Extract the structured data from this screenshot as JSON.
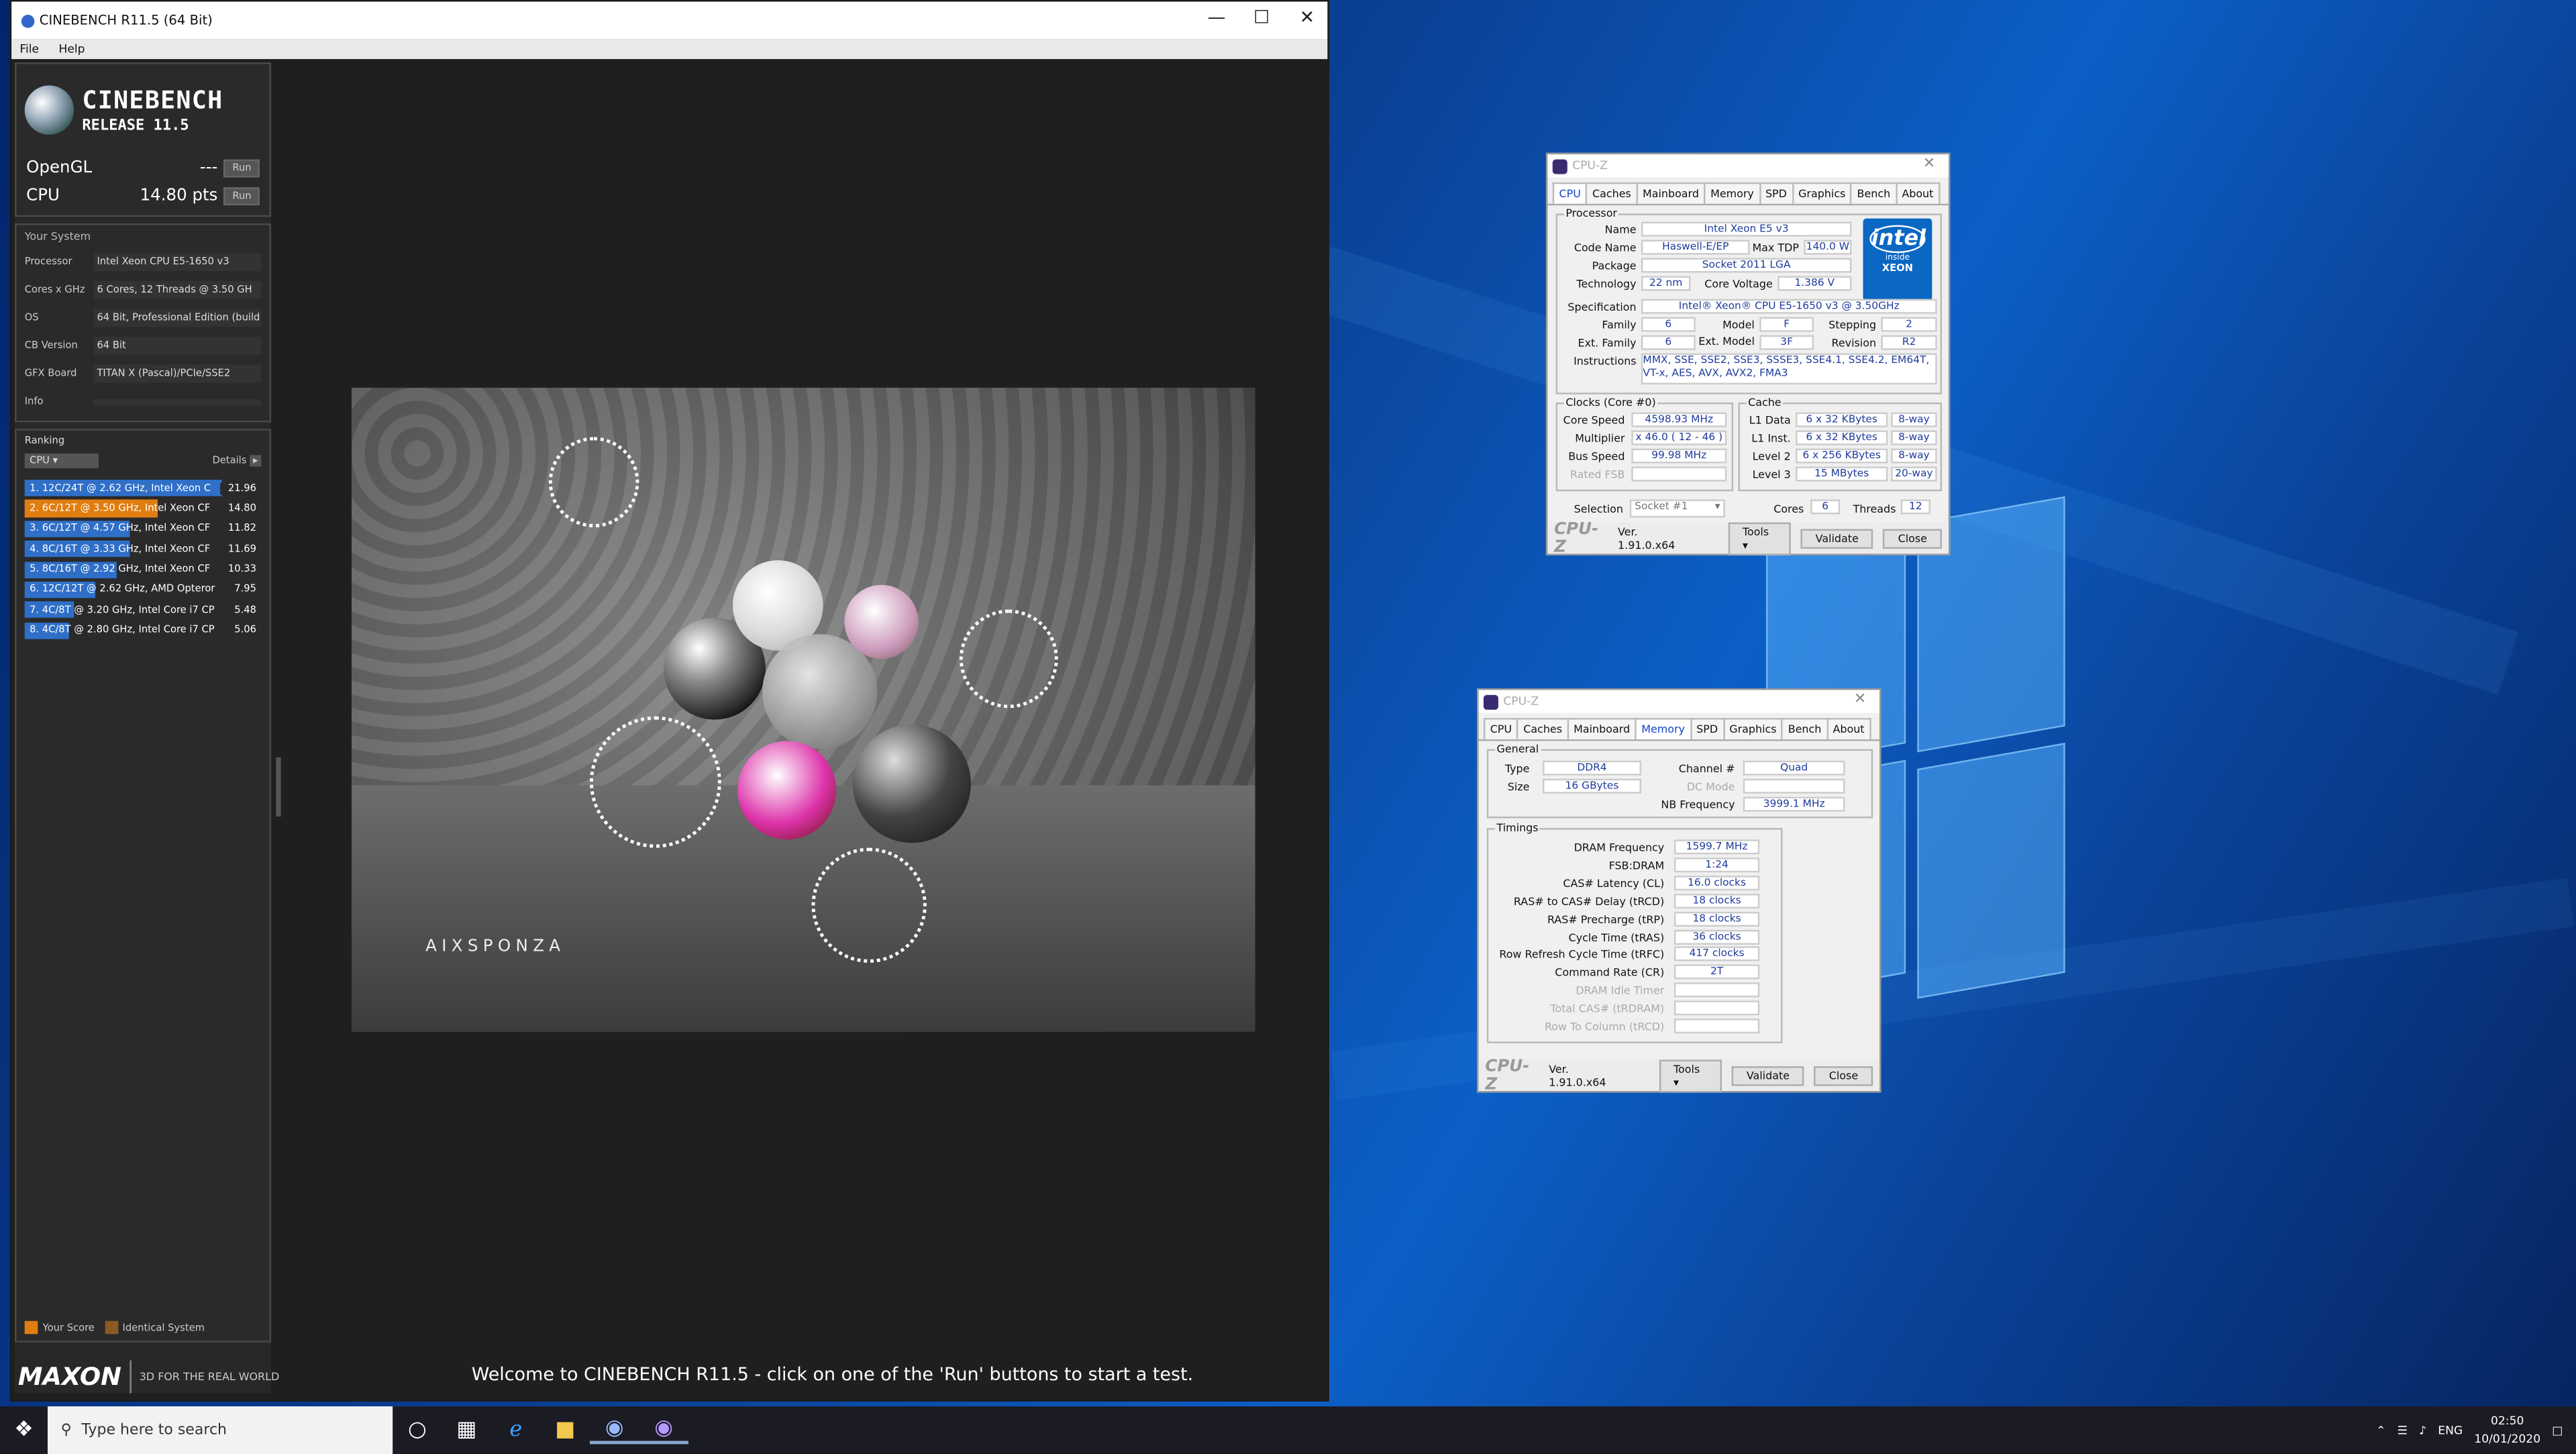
{
  "cinebench": {
    "title": "CINEBENCH R11.5 (64 Bit)",
    "menu": [
      "File",
      "Help"
    ],
    "brand_line1": "CINEBENCH",
    "brand_line2": "RELEASE 11.5",
    "opengl_label": "OpenGL",
    "opengl_value": "---",
    "cpu_label": "CPU",
    "cpu_value": "14.80 pts",
    "run_label": "Run",
    "system_header": "Your System",
    "system": [
      {
        "k": "Processor",
        "v": "Intel Xeon CPU E5-1650 v3"
      },
      {
        "k": "Cores x GHz",
        "v": "6 Cores, 12 Threads @ 3.50 GH"
      },
      {
        "k": "OS",
        "v": "64 Bit, Professional Edition (build"
      },
      {
        "k": "CB Version",
        "v": "64 Bit"
      },
      {
        "k": "GFX Board",
        "v": "TITAN X (Pascal)/PCIe/SSE2"
      },
      {
        "k": "Info",
        "v": ""
      }
    ],
    "ranking_header": "Ranking",
    "ranking_select": "CPU",
    "details_label": "Details",
    "ranking": [
      {
        "t": "1. 12C/24T @ 2.62 GHz, Intel Xeon C",
        "s": "21.96",
        "fill": 1.0,
        "color": "#2f6fc8"
      },
      {
        "t": "2. 6C/12T @ 3.50 GHz, Intel Xeon CF",
        "s": "14.80",
        "fill": 0.674,
        "color": "#e07d10"
      },
      {
        "t": "3. 6C/12T @ 4.57 GHz, Intel Xeon CF",
        "s": "11.82",
        "fill": 0.538,
        "color": "#2f6fc8"
      },
      {
        "t": "4. 8C/16T @ 3.33 GHz, Intel Xeon CF",
        "s": "11.69",
        "fill": 0.532,
        "color": "#2f6fc8"
      },
      {
        "t": "5. 8C/16T @ 2.92 GHz, Intel Xeon CF",
        "s": "10.33",
        "fill": 0.47,
        "color": "#2f6fc8"
      },
      {
        "t": "6. 12C/12T @ 2.62 GHz, AMD Opteror",
        "s": "7.95",
        "fill": 0.362,
        "color": "#2f6fc8"
      },
      {
        "t": "7. 4C/8T @ 3.20 GHz, Intel Core i7 CP",
        "s": "5.48",
        "fill": 0.25,
        "color": "#2f6fc8"
      },
      {
        "t": "8. 4C/8T @ 2.80 GHz, Intel Core i7 CP",
        "s": "5.06",
        "fill": 0.23,
        "color": "#2f6fc8"
      }
    ],
    "legend_your": "Your Score",
    "legend_identical": "Identical System",
    "maxon": "MAXON",
    "tagline": "3D FOR THE REAL WORLD",
    "render_brand": "AIXSPONZA",
    "welcome": "Welcome to CINEBENCH R11.5 - click on one of the 'Run' buttons to start a test."
  },
  "cpuz1": {
    "title": "CPU-Z",
    "tabs": [
      "CPU",
      "Caches",
      "Mainboard",
      "Memory",
      "SPD",
      "Graphics",
      "Bench",
      "About"
    ],
    "processor_label": "Processor",
    "name_label": "Name",
    "name": "Intel Xeon E5 v3",
    "codename_label": "Code Name",
    "codename": "Haswell-E/EP",
    "maxtdp_label": "Max TDP",
    "maxtdp": "140.0 W",
    "package_label": "Package",
    "package": "Socket 2011 LGA",
    "technology_label": "Technology",
    "technology": "22 nm",
    "corevoltage_label": "Core Voltage",
    "corevoltage": "1.386 V",
    "spec_label": "Specification",
    "spec": "Intel® Xeon® CPU E5-1650 v3 @ 3.50GHz",
    "family_label": "Family",
    "family": "6",
    "model_label": "Model",
    "model": "F",
    "stepping_label": "Stepping",
    "stepping": "2",
    "extfamily_label": "Ext. Family",
    "extfamily": "6",
    "extmodel_label": "Ext. Model",
    "extmodel": "3F",
    "revision_label": "Revision",
    "revision": "R2",
    "instructions_label": "Instructions",
    "instructions": "MMX, SSE, SSE2, SSE3, SSSE3, SSE4.1, SSE4.2, EM64T, VT-x, AES, AVX, AVX2, FMA3",
    "clocks_label": "Clocks (Core #0)",
    "corespeed_label": "Core Speed",
    "corespeed": "4598.93 MHz",
    "multiplier_label": "Multiplier",
    "multiplier": "x 46.0 ( 12 - 46 )",
    "busspeed_label": "Bus Speed",
    "busspeed": "99.98 MHz",
    "ratedfsb_label": "Rated FSB",
    "cache_label": "Cache",
    "l1d_label": "L1 Data",
    "l1d": "6 x 32 KBytes",
    "l1d_way": "8-way",
    "l1i_label": "L1 Inst.",
    "l1i": "6 x 32 KBytes",
    "l1i_way": "8-way",
    "l2_label": "Level 2",
    "l2": "6 x 256 KBytes",
    "l2_way": "8-way",
    "l3_label": "Level 3",
    "l3": "15 MBytes",
    "l3_way": "20-way",
    "selection_label": "Selection",
    "selection": "Socket #1",
    "cores_label": "Cores",
    "cores": "6",
    "threads_label": "Threads",
    "threads": "12",
    "logo": "CPU-Z",
    "version": "Ver. 1.91.0.x64",
    "tools": "Tools",
    "validate": "Validate",
    "close": "Close",
    "intel_brand": "intel",
    "intel_inside": "inside",
    "intel_xeon": "XEON"
  },
  "cpuz2": {
    "title": "CPU-Z",
    "tabs": [
      "CPU",
      "Caches",
      "Mainboard",
      "Memory",
      "SPD",
      "Graphics",
      "Bench",
      "About"
    ],
    "general_label": "General",
    "type_label": "Type",
    "type": "DDR4",
    "size_label": "Size",
    "size": "16 GBytes",
    "channel_label": "Channel #",
    "channel": "Quad",
    "dcmode_label": "DC Mode",
    "nbfreq_label": "NB Frequency",
    "nbfreq": "3999.1 MHz",
    "timings_label": "Timings",
    "timings": [
      {
        "k": "DRAM Frequency",
        "v": "1599.7 MHz",
        "dim": false
      },
      {
        "k": "FSB:DRAM",
        "v": "1:24",
        "dim": false
      },
      {
        "k": "CAS# Latency (CL)",
        "v": "16.0 clocks",
        "dim": false
      },
      {
        "k": "RAS# to CAS# Delay (tRCD)",
        "v": "18 clocks",
        "dim": false
      },
      {
        "k": "RAS# Precharge (tRP)",
        "v": "18 clocks",
        "dim": false
      },
      {
        "k": "Cycle Time (tRAS)",
        "v": "36 clocks",
        "dim": false
      },
      {
        "k": "Row Refresh Cycle Time (tRFC)",
        "v": "417 clocks",
        "dim": false
      },
      {
        "k": "Command Rate (CR)",
        "v": "2T",
        "dim": false
      },
      {
        "k": "DRAM Idle Timer",
        "v": "",
        "dim": true
      },
      {
        "k": "Total CAS# (tRDRAM)",
        "v": "",
        "dim": true
      },
      {
        "k": "Row To Column (tRCD)",
        "v": "",
        "dim": true
      }
    ],
    "logo": "CPU-Z",
    "version": "Ver. 1.91.0.x64",
    "tools": "Tools",
    "validate": "Validate",
    "close": "Close"
  },
  "taskbar": {
    "search_placeholder": "Type here to search",
    "lang": "ENG",
    "time": "02:50",
    "date": "10/01/2020"
  }
}
